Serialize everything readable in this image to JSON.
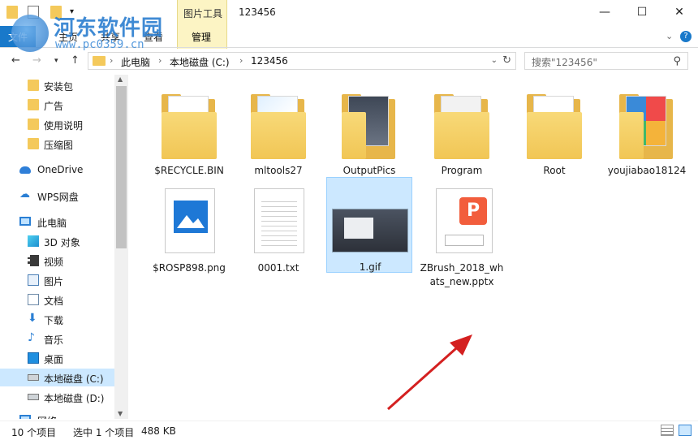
{
  "window": {
    "title": "123456",
    "context_group": "图片工具",
    "minimize": "—",
    "maximize": "☐",
    "close": "✕"
  },
  "ribbon": {
    "file_tab": "文件",
    "tabs": [
      "主页",
      "共享",
      "查看",
      "管理"
    ],
    "active_tab": "管理",
    "collapse": "⌄",
    "help": "?"
  },
  "watermark": {
    "name": "河东软件园",
    "url": "www.pc0359.cn"
  },
  "address": {
    "crumbs": [
      "此电脑",
      "本地磁盘 (C:)",
      "123456"
    ],
    "search_placeholder": "搜索\"123456\""
  },
  "nav": {
    "quick": [
      "安装包",
      "广告",
      "使用说明",
      "压缩图"
    ],
    "onedrive": "OneDrive",
    "wps": "WPS网盘",
    "this_pc": "此电脑",
    "pc_items": [
      "3D 对象",
      "视频",
      "图片",
      "文档",
      "下载",
      "音乐",
      "桌面",
      "本地磁盘 (C:)",
      "本地磁盘 (D:)"
    ],
    "network": "网络"
  },
  "files": [
    {
      "name": "$RECYCLE.BIN",
      "kind": "folder"
    },
    {
      "name": "mltools27",
      "kind": "folder"
    },
    {
      "name": "OutputPics",
      "kind": "folder"
    },
    {
      "name": "Program",
      "kind": "folder"
    },
    {
      "name": "Root",
      "kind": "folder"
    },
    {
      "name": "youjiabao18124",
      "kind": "folder"
    },
    {
      "name": "$ROSP898.png",
      "kind": "image"
    },
    {
      "name": "0001.txt",
      "kind": "text"
    },
    {
      "name": "1.gif",
      "kind": "gif",
      "selected": true
    },
    {
      "name": "ZBrush_2018_whats_new.pptx",
      "kind": "pptx"
    }
  ],
  "status": {
    "count": "10 个项目",
    "selected": "选中 1 个项目",
    "size": "488 KB"
  },
  "colors": {
    "accent": "#1979ca",
    "selection": "#cce8ff",
    "folder": "#f4c95b",
    "arrow": "#d42020"
  }
}
